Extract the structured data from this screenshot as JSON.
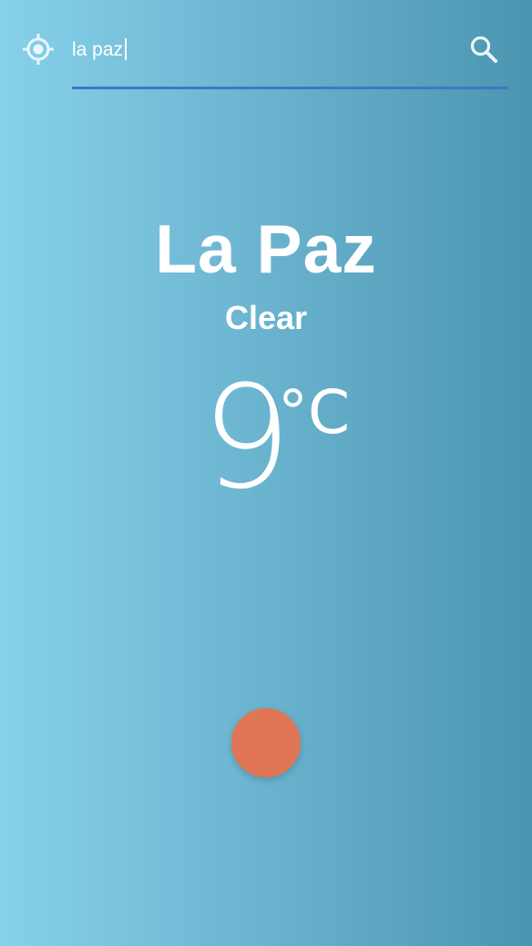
{
  "search": {
    "value": "la paz",
    "placeholder": ""
  },
  "icons": {
    "location": "my-location-icon",
    "search": "search-icon"
  },
  "weather": {
    "city": "La Paz",
    "condition": "Clear",
    "temperature": "9",
    "unit": "°C"
  },
  "colors": {
    "gradient_start": "#86d1ea",
    "gradient_end": "#4a95b0",
    "underline": "#3d78c9",
    "fab": "#e07655"
  }
}
